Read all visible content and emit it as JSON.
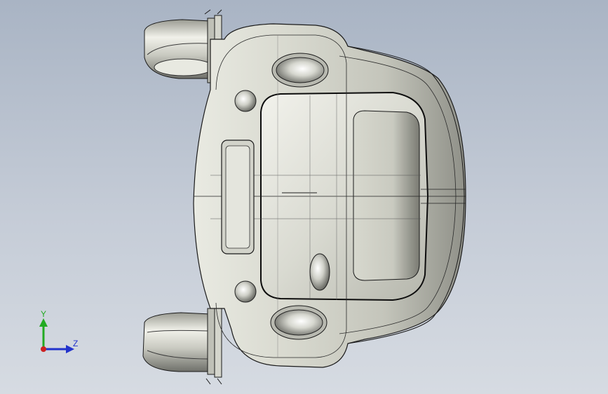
{
  "viewport": {
    "background_top": "#a9b4c4",
    "background_bottom": "#d6dbe2"
  },
  "model": {
    "body_color": "#cfd0c6",
    "edge_color": "#1a1a1a"
  },
  "triad": {
    "y_label": "Y",
    "z_label": "Z",
    "y_color": "#22aa22",
    "z_color": "#2233cc",
    "x_color": "#cc2222"
  }
}
